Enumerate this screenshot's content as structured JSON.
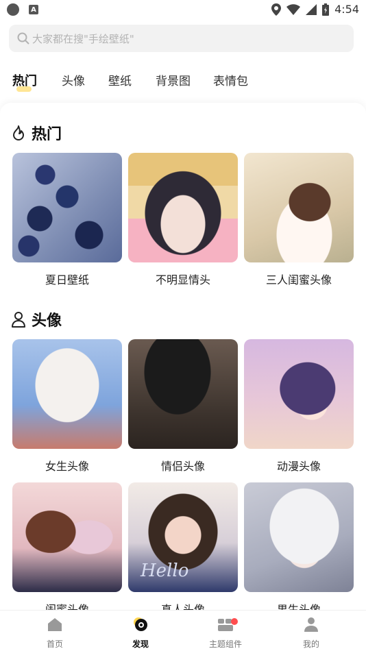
{
  "status_bar": {
    "time": "4:54",
    "icons": [
      "app-circle-icon",
      "a-icon",
      "location-icon",
      "wifi-icon",
      "signal-icon",
      "battery-icon"
    ]
  },
  "search": {
    "placeholder": "大家都在搜\"手绘壁纸\""
  },
  "tabs": [
    {
      "label": "热门",
      "active": true
    },
    {
      "label": "头像",
      "active": false
    },
    {
      "label": "壁纸",
      "active": false
    },
    {
      "label": "背景图",
      "active": false
    },
    {
      "label": "表情包",
      "active": false
    }
  ],
  "sections": [
    {
      "title": "热门",
      "icon": "flame-icon",
      "items": [
        {
          "label": "夏日壁纸"
        },
        {
          "label": "不明显情头"
        },
        {
          "label": "三人闺蜜头像"
        }
      ]
    },
    {
      "title": "头像",
      "icon": "person-icon",
      "items": [
        {
          "label": "女生头像"
        },
        {
          "label": "情侣头像"
        },
        {
          "label": "动漫头像"
        },
        {
          "label": "闺蜜头像"
        },
        {
          "label": "真人头像",
          "overlay_text": "Hello"
        },
        {
          "label": "男生头像"
        }
      ]
    }
  ],
  "bottom_nav": [
    {
      "label": "首页",
      "icon": "home-icon",
      "active": false
    },
    {
      "label": "发现",
      "icon": "discover-icon",
      "active": true
    },
    {
      "label": "主题组件",
      "icon": "widgets-icon",
      "active": false,
      "badge": true
    },
    {
      "label": "我的",
      "icon": "profile-icon",
      "active": false
    }
  ],
  "colors": {
    "accent": "#ffd54f",
    "badge": "#ff4d4f",
    "search_bg": "#f2f2f2"
  }
}
